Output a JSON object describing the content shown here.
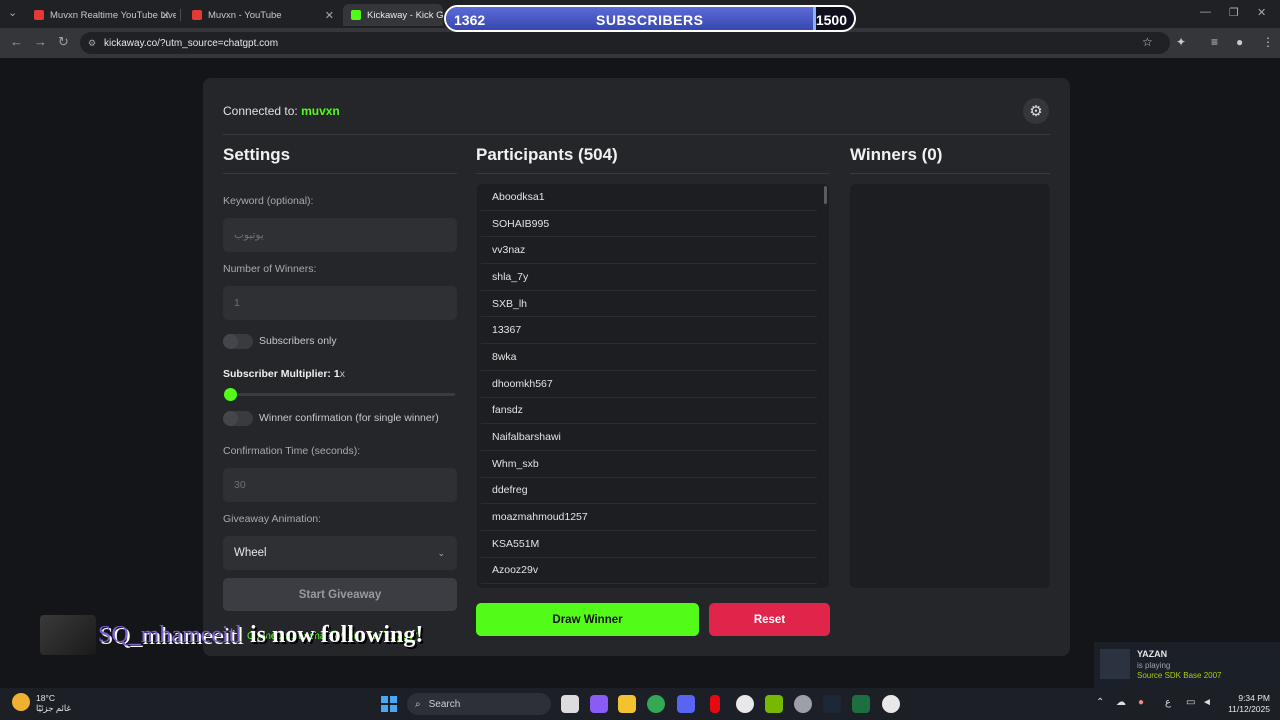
{
  "browser": {
    "tabs": [
      {
        "title": "Muvxn Realtime YouTube Live S",
        "favicon_color": "#e53935",
        "active": false
      },
      {
        "title": "Muvxn - YouTube",
        "favicon_color": "#e53935",
        "active": false
      },
      {
        "title": "Kickaway - Kick Giveaw",
        "favicon_color": "#53fc18",
        "active": true
      }
    ],
    "url": "kickaway.co/?utm_source=chatgpt.com"
  },
  "overlay": {
    "subscribers": {
      "current": "1362",
      "title": "SUBSCRIBERS",
      "goal": "1500",
      "progress_fraction": 0.908
    },
    "follow": {
      "name": "SQ_mhameeitl",
      "text": "is now following!"
    }
  },
  "app": {
    "connected_label": "Connected to:",
    "channel": "muvxn",
    "settings": {
      "title": "Settings",
      "keyword_label": "Keyword (optional):",
      "keyword_placeholder": "يوتيوب",
      "winners_label": "Number of Winners:",
      "winners_placeholder": "1",
      "subs_only_label": "Subscribers only",
      "multiplier_label": "Subscriber Multiplier: 1",
      "multiplier_suffix": "x",
      "multiplier_value": 1,
      "confirm_label": "Winner confirmation (for single winner)",
      "confirm_time_label": "Confirmation Time (seconds):",
      "confirm_time_placeholder": "30",
      "animation_label": "Giveaway Animation:",
      "animation_value": "Wheel",
      "start_button": "Start Giveaway",
      "status_text": "Connected to chat! Waiting for \"يوتيوب\"."
    },
    "participants": {
      "title": "Participants (504)",
      "items": [
        "Aboodksa1",
        "SOHAIB995",
        "vv3naz",
        "shla_7y",
        "SXB_lh",
        "13367",
        "8wka",
        "dhoomkh567",
        "fansdz",
        "Naifalbarshawi",
        "Whm_sxb",
        "ddefreg",
        "moazmahmoud1257",
        "KSA551M",
        "Azooz29v"
      ]
    },
    "winners": {
      "title": "Winners (0)"
    },
    "draw_button": "Draw Winner",
    "reset_button": "Reset"
  },
  "steam_notification": {
    "name": "YAZAN",
    "state": "is playing",
    "game": "Source SDK Base 2007"
  },
  "taskbar": {
    "temperature": "18°C",
    "weather_desc": "غائم جزئيًا",
    "search_label": "Search",
    "lang": "ع",
    "time": "9:34 PM",
    "date": "11/12/2025"
  }
}
